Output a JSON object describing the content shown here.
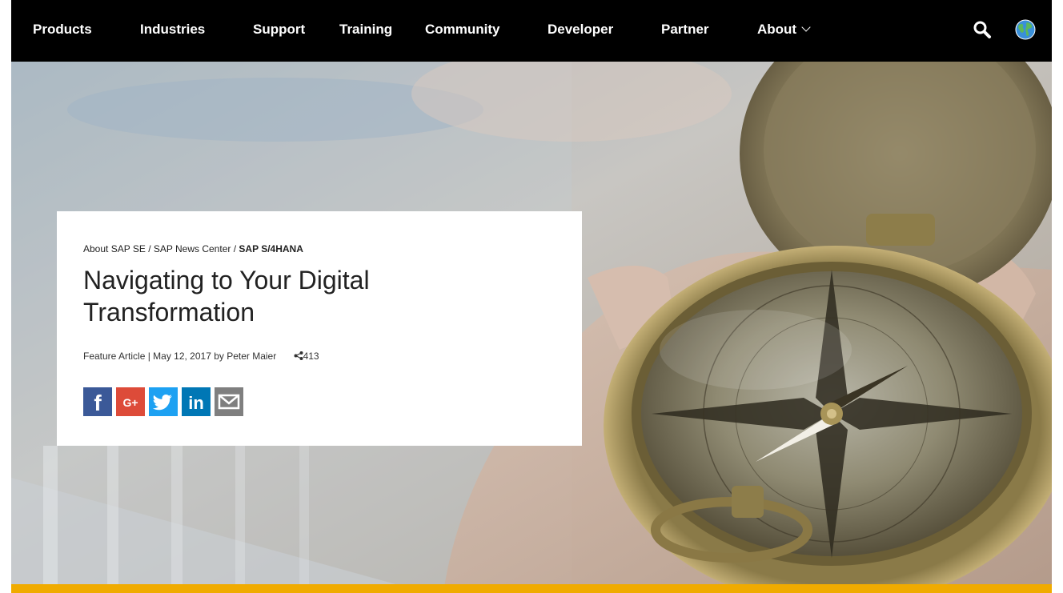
{
  "nav": {
    "items": [
      "Products",
      "Industries",
      "Support",
      "Training",
      "Community",
      "Developer",
      "Partner",
      "About"
    ],
    "search_icon": "search-icon",
    "globe_icon": "globe-icon"
  },
  "article": {
    "breadcrumb": [
      "About SAP SE",
      "SAP News Center",
      "SAP S/4HANA"
    ],
    "breadcrumb_separator": "/",
    "title_line1": "Navigating to Your Digital",
    "title_line2": "Transformation",
    "meta": "Feature Article | May 12, 2017 by Peter Maier",
    "share_count": "413"
  },
  "social": {
    "facebook": "f",
    "googleplus": "G+",
    "linkedin": "in"
  },
  "colors": {
    "nav_bg": "#000000",
    "accent_yellow": "#f0ab00",
    "facebook": "#3b5998",
    "googleplus": "#dd4b39",
    "twitter": "#1da1f2",
    "linkedin": "#0077b5",
    "email": "#7f7f7f"
  }
}
